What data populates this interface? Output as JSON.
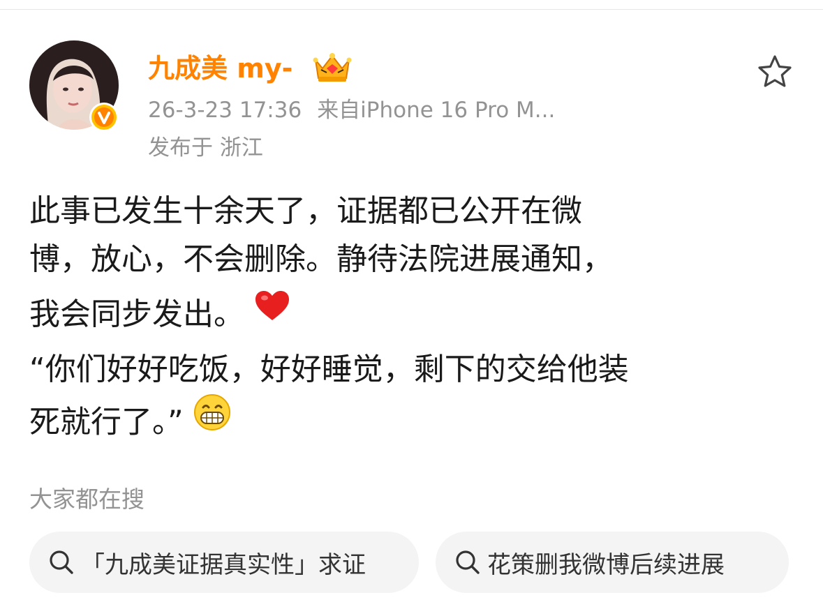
{
  "post": {
    "author": {
      "name": "九成美 my-",
      "verified_icon": "verified-v-badge",
      "member_badge": "crown-icon",
      "name_color": "#ff8200"
    },
    "meta": {
      "time": "26-3-23 17:36",
      "source": "来自iPhone 16 Pro M...",
      "location": "发布于 浙江"
    },
    "favorite_icon": "star-outline-icon",
    "content": {
      "line1": "此事已发生十余天了，证据都已公开在微",
      "line2": "博，放心，不会删除。静待法院进展通知，",
      "line3": "我会同步发出。",
      "line3_emoji": "heart-emoji",
      "line4": "“你们好好吃饭，好好睡觉，剩下的交给他装",
      "line5": "死就行了。”",
      "line5_emoji": "grin-emoji"
    }
  },
  "trending": {
    "label": "大家都在搜",
    "chips": [
      {
        "icon": "search-icon",
        "text": "「九成美证据真实性」求证"
      },
      {
        "icon": "search-icon",
        "text": "花策删我微博后续进展"
      }
    ]
  },
  "colors": {
    "accent_orange": "#ff8200",
    "muted_text": "#939393",
    "body_text": "#1a1a1a",
    "chip_bg": "#f4f4f4"
  }
}
